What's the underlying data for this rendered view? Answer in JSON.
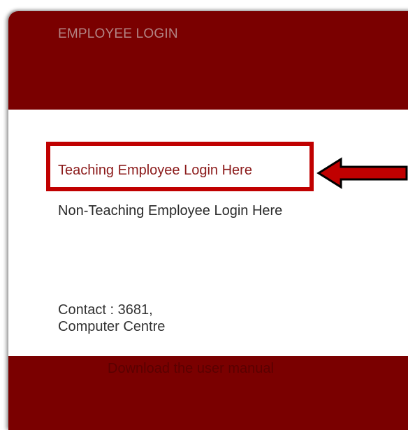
{
  "header": {
    "title": "EMPLOYEE LOGIN"
  },
  "links": {
    "teaching": "Teaching Employee Login Here",
    "non_teaching": "Non-Teaching Employee Login Here"
  },
  "contact": {
    "line1": "Contact : 3681,",
    "line2": "Computer Centre"
  },
  "footer": {
    "manual_link": "Download the user manual"
  },
  "colors": {
    "brand": "#7a0000",
    "annotation_red": "#c00000",
    "link_red": "#8b1a1a"
  },
  "annotation": {
    "icon": "left-arrow-icon"
  }
}
